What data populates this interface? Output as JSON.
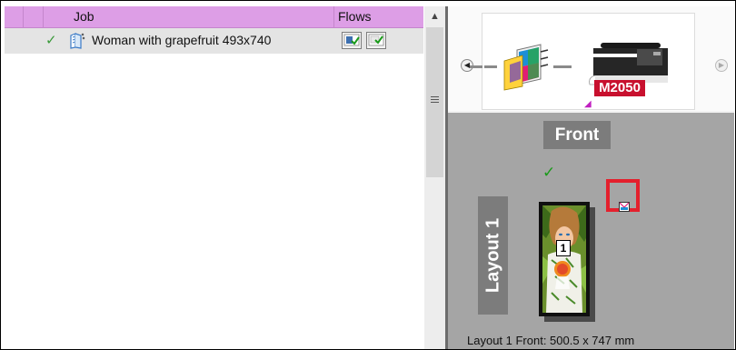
{
  "job_list": {
    "columns": [
      "Job",
      "Flows"
    ],
    "rows": [
      {
        "status": "checkmark",
        "name": "Woman with grapefruit 493x740",
        "flow_icons": [
          "flow-icon",
          "flow-icon"
        ]
      }
    ]
  },
  "flow_strip": {
    "printer_label": "M2050"
  },
  "layout": {
    "side_label": "Front",
    "layout_label": "Layout 1",
    "page_number": "1",
    "dimensions": "Layout 1 Front: 500.5 x 747 mm"
  },
  "colors": {
    "header_accent": "#dd9ee6",
    "selected_row": "#e4e4e4",
    "layout_background": "#a5a5a5",
    "label_background": "#7c7c7c",
    "highlight_red": "#e4202d",
    "printer_red": "#c8102e",
    "check_green": "#1a9a1a"
  }
}
